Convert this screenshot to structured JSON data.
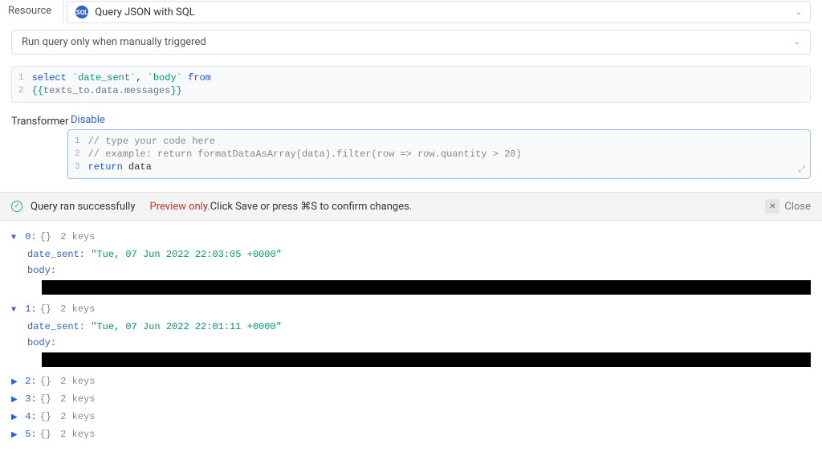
{
  "header": {
    "resource_label": "Resource",
    "sql_badge": "SQL",
    "resource_name": "Query JSON with SQL"
  },
  "trigger": {
    "label": "Run query only when manually triggered"
  },
  "query_editor": {
    "lines": [
      {
        "n": "1",
        "segments": [
          {
            "t": "select ",
            "c": "kw-blue"
          },
          {
            "t": "`date_sent`",
            "c": "kw-green"
          },
          {
            "t": ", ",
            "c": ""
          },
          {
            "t": "`body`",
            "c": "kw-green"
          },
          {
            "t": " from",
            "c": "kw-blue"
          }
        ]
      },
      {
        "n": "2",
        "segments": [
          {
            "t": "{{",
            "c": "kw-green"
          },
          {
            "t": "texts_to",
            "c": "kw-gray"
          },
          {
            "t": ".",
            "c": "kw-green"
          },
          {
            "t": "data",
            "c": "kw-gray"
          },
          {
            "t": ".",
            "c": "kw-green"
          },
          {
            "t": "messages",
            "c": "kw-gray"
          },
          {
            "t": "}}",
            "c": "kw-green"
          }
        ]
      }
    ]
  },
  "transformer": {
    "label": "Transformer",
    "disable": "Disable",
    "lines": [
      {
        "n": "1",
        "segments": [
          {
            "t": "// type your code here",
            "c": "cm-comment"
          }
        ]
      },
      {
        "n": "2",
        "segments": [
          {
            "t": "// example: return formatDataAsArray(data).filter(row => row.quantity > 20)",
            "c": "cm-comment"
          }
        ]
      },
      {
        "n": "3",
        "segments": [
          {
            "t": "return",
            "c": "cm-return"
          },
          {
            "t": " data",
            "c": ""
          }
        ]
      }
    ]
  },
  "status": {
    "success": "Query ran successfully",
    "preview": "Preview only.",
    "confirm": " Click Save or press ⌘S to confirm changes.",
    "close": "Close"
  },
  "results": {
    "keys_label": "2 keys",
    "date_sent_key": "date_sent:",
    "body_key": "body:",
    "items": [
      {
        "idx": "0",
        "expanded": true,
        "date_sent": "\"Tue, 07 Jun 2022 22:03:05 +0000\""
      },
      {
        "idx": "1",
        "expanded": true,
        "date_sent": "\"Tue, 07 Jun 2022 22:01:11 +0000\""
      },
      {
        "idx": "2",
        "expanded": false
      },
      {
        "idx": "3",
        "expanded": false
      },
      {
        "idx": "4",
        "expanded": false
      },
      {
        "idx": "5",
        "expanded": false
      }
    ]
  }
}
